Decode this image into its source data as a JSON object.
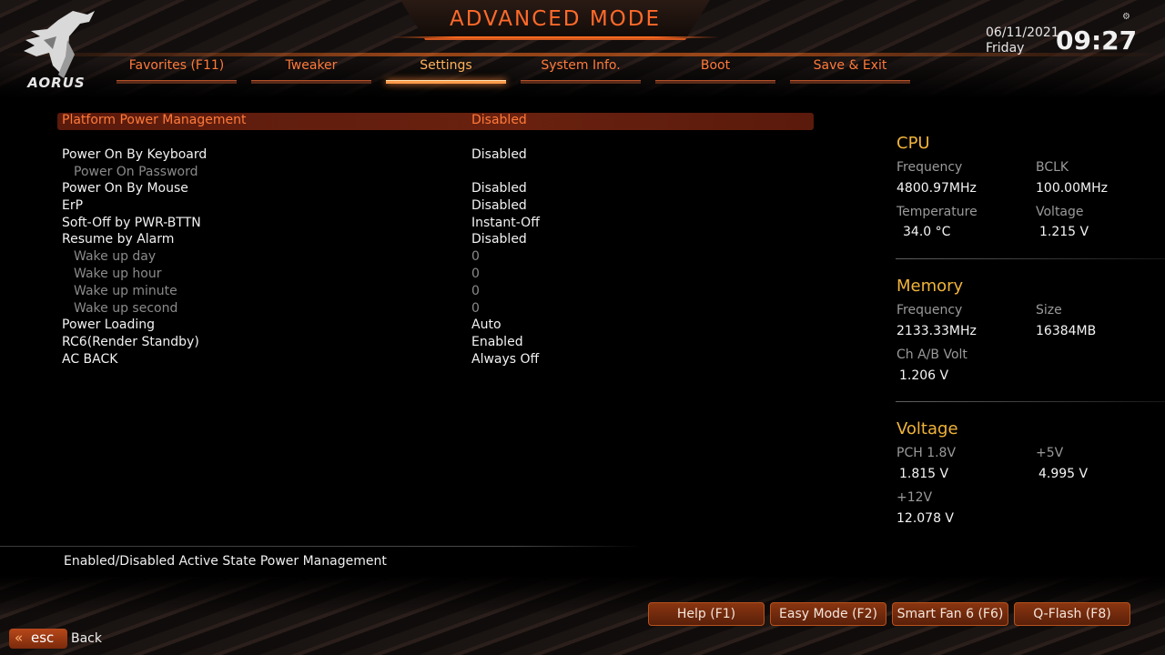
{
  "header": {
    "mode_title": "ADVANCED MODE",
    "logo_text": "AORUS",
    "date": "06/11/2021",
    "day": "Friday",
    "time": "09:27",
    "accent_color": "#ff6a2a"
  },
  "tabs": [
    {
      "label": "Favorites (F11)",
      "active": false
    },
    {
      "label": "Tweaker",
      "active": false
    },
    {
      "label": "Settings",
      "active": true
    },
    {
      "label": "System Info.",
      "active": false
    },
    {
      "label": "Boot",
      "active": false
    },
    {
      "label": "Save & Exit",
      "active": false
    }
  ],
  "settings": [
    {
      "label": "Platform Power Management",
      "value": "Disabled"
    },
    {
      "label": "Power On By Keyboard",
      "value": "Disabled"
    },
    {
      "label": "Power On Password",
      "value": ""
    },
    {
      "label": "Power On By Mouse",
      "value": "Disabled"
    },
    {
      "label": "ErP",
      "value": "Disabled"
    },
    {
      "label": "Soft-Off by PWR-BTTN",
      "value": "Instant-Off"
    },
    {
      "label": "Resume by Alarm",
      "value": "Disabled"
    },
    {
      "label": "Wake up day",
      "value": "0"
    },
    {
      "label": "Wake up hour",
      "value": "0"
    },
    {
      "label": "Wake up minute",
      "value": "0"
    },
    {
      "label": "Wake up second",
      "value": "0"
    },
    {
      "label": "Power Loading",
      "value": "Auto"
    },
    {
      "label": "RC6(Render Standby)",
      "value": "Enabled"
    },
    {
      "label": "AC BACK",
      "value": "Always Off"
    }
  ],
  "help_text": "Enabled/Disabled Active State Power Management",
  "cpu": {
    "title": "CPU",
    "frequency_label": "Frequency",
    "frequency": "4800.97MHz",
    "bclk_label": "BCLK",
    "bclk": "100.00MHz",
    "temperature_label": "Temperature",
    "temperature": "34.0 °C",
    "voltage_label": "Voltage",
    "voltage": "1.215 V"
  },
  "memory": {
    "title": "Memory",
    "frequency_label": "Frequency",
    "frequency": "2133.33MHz",
    "size_label": "Size",
    "size": "16384MB",
    "chab_label": "Ch A/B Volt",
    "chab": "1.206 V"
  },
  "voltage": {
    "title": "Voltage",
    "pch_label": "PCH 1.8V",
    "pch": "1.815 V",
    "p5v_label": "+5V",
    "p5v": "4.995 V",
    "p12v_label": "+12V",
    "p12v": "12.078 V"
  },
  "footer": {
    "help_btn": "Help (F1)",
    "easy_btn": "Easy Mode (F2)",
    "fan_btn": "Smart Fan 6 (F6)",
    "qflash_btn": "Q-Flash (F8)",
    "esc_chevron": "«",
    "esc_label": "esc",
    "back_label": "Back"
  }
}
